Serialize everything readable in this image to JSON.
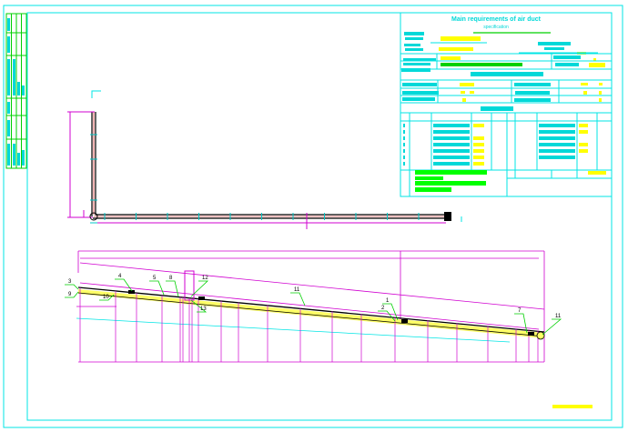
{
  "title_block": {
    "title": "Main requirements of air duct",
    "subtitle": "specification"
  },
  "callouts": [
    "3",
    "9",
    "4",
    "10",
    "5",
    "8",
    "12",
    "13",
    "11",
    "1",
    "2",
    "7",
    "11"
  ],
  "colors": {
    "frame": "#00e5e5",
    "dimension": "#d000d0",
    "leader": "#00d000",
    "duct": "#000000",
    "fill": "#ffff66",
    "highlight": "#00ff00",
    "stamp": "#ffff00"
  }
}
